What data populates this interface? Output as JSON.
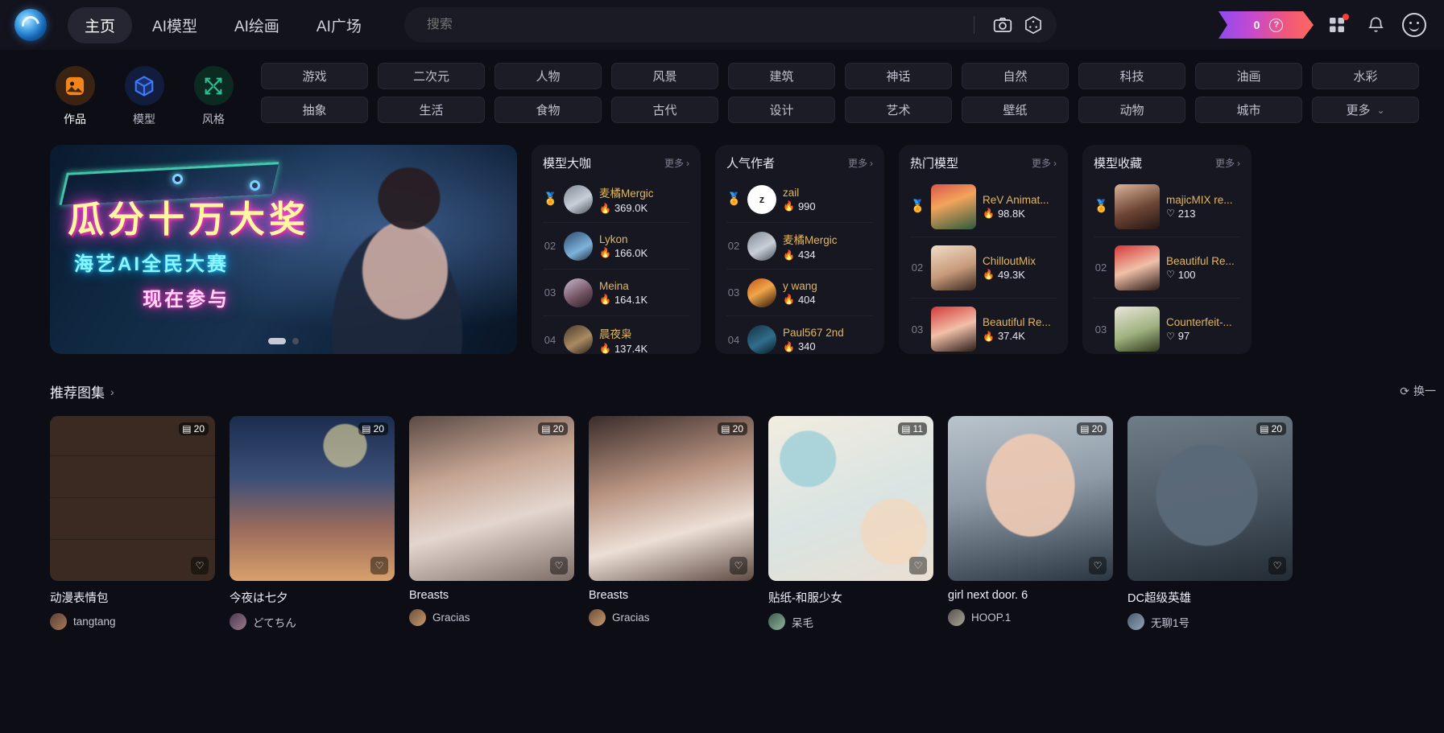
{
  "header": {
    "logo_name": "site-logo",
    "nav": [
      {
        "label": "主页",
        "active": true
      },
      {
        "label": "AI模型",
        "active": false
      },
      {
        "label": "AI绘画",
        "active": false
      },
      {
        "label": "AI广场",
        "active": false
      }
    ],
    "search": {
      "value": "",
      "placeholder": "搜索"
    },
    "camera_icon": "camera-icon",
    "dice_icon": "dice-icon",
    "credits": {
      "value": "0",
      "help": "?"
    },
    "apps_icon": "apps-grid-icon",
    "bell_icon": "bell-icon",
    "profile_icon": "profile-face-icon"
  },
  "categories": [
    {
      "label": "作品",
      "icon": "artwork-icon",
      "active": true
    },
    {
      "label": "模型",
      "icon": "model-cube-icon",
      "active": false
    },
    {
      "label": "风格",
      "icon": "style-expand-icon",
      "active": false
    }
  ],
  "tags_row1": [
    "游戏",
    "二次元",
    "人物",
    "风景",
    "建筑",
    "神话",
    "自然",
    "科技",
    "油画",
    "水彩"
  ],
  "tags_row2": [
    "抽象",
    "生活",
    "食物",
    "古代",
    "设计",
    "艺术",
    "壁纸",
    "动物",
    "城市"
  ],
  "tags_more": "更多",
  "banner": {
    "title": "瓜分十万大奖",
    "subtitle": "海艺AI全民大赛",
    "cta": "现在参与",
    "pagination": [
      "active",
      "inactive"
    ]
  },
  "leaderboards": [
    {
      "title": "模型大咖",
      "more": "更多",
      "stat_icon": "flame-icon",
      "avatar_shape": "circle",
      "rows": [
        {
          "rank": "01",
          "medal": "🏅",
          "name": "麦橘Mergic",
          "stat": "369.0K"
        },
        {
          "rank": "02",
          "medal": "",
          "name": "Lykon",
          "stat": "166.0K"
        },
        {
          "rank": "03",
          "medal": "",
          "name": "Meina",
          "stat": "164.1K"
        },
        {
          "rank": "04",
          "medal": "",
          "name": "晨夜枭",
          "stat": "137.4K"
        }
      ]
    },
    {
      "title": "人气作者",
      "more": "更多",
      "stat_icon": "flame-icon",
      "avatar_shape": "circle",
      "rows": [
        {
          "rank": "01",
          "medal": "🏅",
          "name": "zail",
          "stat": "990",
          "initial": "z"
        },
        {
          "rank": "02",
          "medal": "",
          "name": "麦橘Mergic",
          "stat": "434"
        },
        {
          "rank": "03",
          "medal": "",
          "name": "y wang",
          "stat": "404"
        },
        {
          "rank": "04",
          "medal": "",
          "name": "Paul567 2nd",
          "stat": "340"
        }
      ]
    },
    {
      "title": "热门模型",
      "more": "更多",
      "stat_icon": "flame-icon",
      "avatar_shape": "square",
      "rows": [
        {
          "rank": "01",
          "medal": "🏅",
          "name": "ReV Animat...",
          "stat": "98.8K"
        },
        {
          "rank": "02",
          "medal": "",
          "name": "ChilloutMix",
          "stat": "49.3K"
        },
        {
          "rank": "03",
          "medal": "",
          "name": "Beautiful Re...",
          "stat": "37.4K"
        }
      ]
    },
    {
      "title": "模型收藏",
      "more": "更多",
      "stat_icon": "heart-icon",
      "avatar_shape": "square",
      "rows": [
        {
          "rank": "01",
          "medal": "🏅",
          "name": "majicMIX re...",
          "stat": "213"
        },
        {
          "rank": "02",
          "medal": "",
          "name": "Beautiful Re...",
          "stat": "100"
        },
        {
          "rank": "03",
          "medal": "",
          "name": "Counterfeit-...",
          "stat": "97"
        }
      ]
    }
  ],
  "recommend": {
    "title": "推荐图集",
    "refresh_label": "换一",
    "cards": [
      {
        "title": "动漫表情包",
        "user": "tangtang",
        "count": "20"
      },
      {
        "title": "今夜は七夕",
        "user": "どてちん",
        "count": "20"
      },
      {
        "title": "Breasts",
        "user": "Gracias",
        "count": "20"
      },
      {
        "title": "Breasts",
        "user": "Gracias",
        "count": "20"
      },
      {
        "title": "贴纸-和服少女",
        "user": "呆毛",
        "count": "11"
      },
      {
        "title": "girl next door. 6",
        "user": "HOOP.1",
        "count": "20"
      },
      {
        "title": "DC超级英雄",
        "user": "无聊1号",
        "count": "20"
      }
    ]
  },
  "colors": {
    "bg": "#0d0d15",
    "panel": "#171722",
    "accent_gold": "#e0b760",
    "flame": "#e0443c",
    "badge_red": "#ff3b3b"
  }
}
